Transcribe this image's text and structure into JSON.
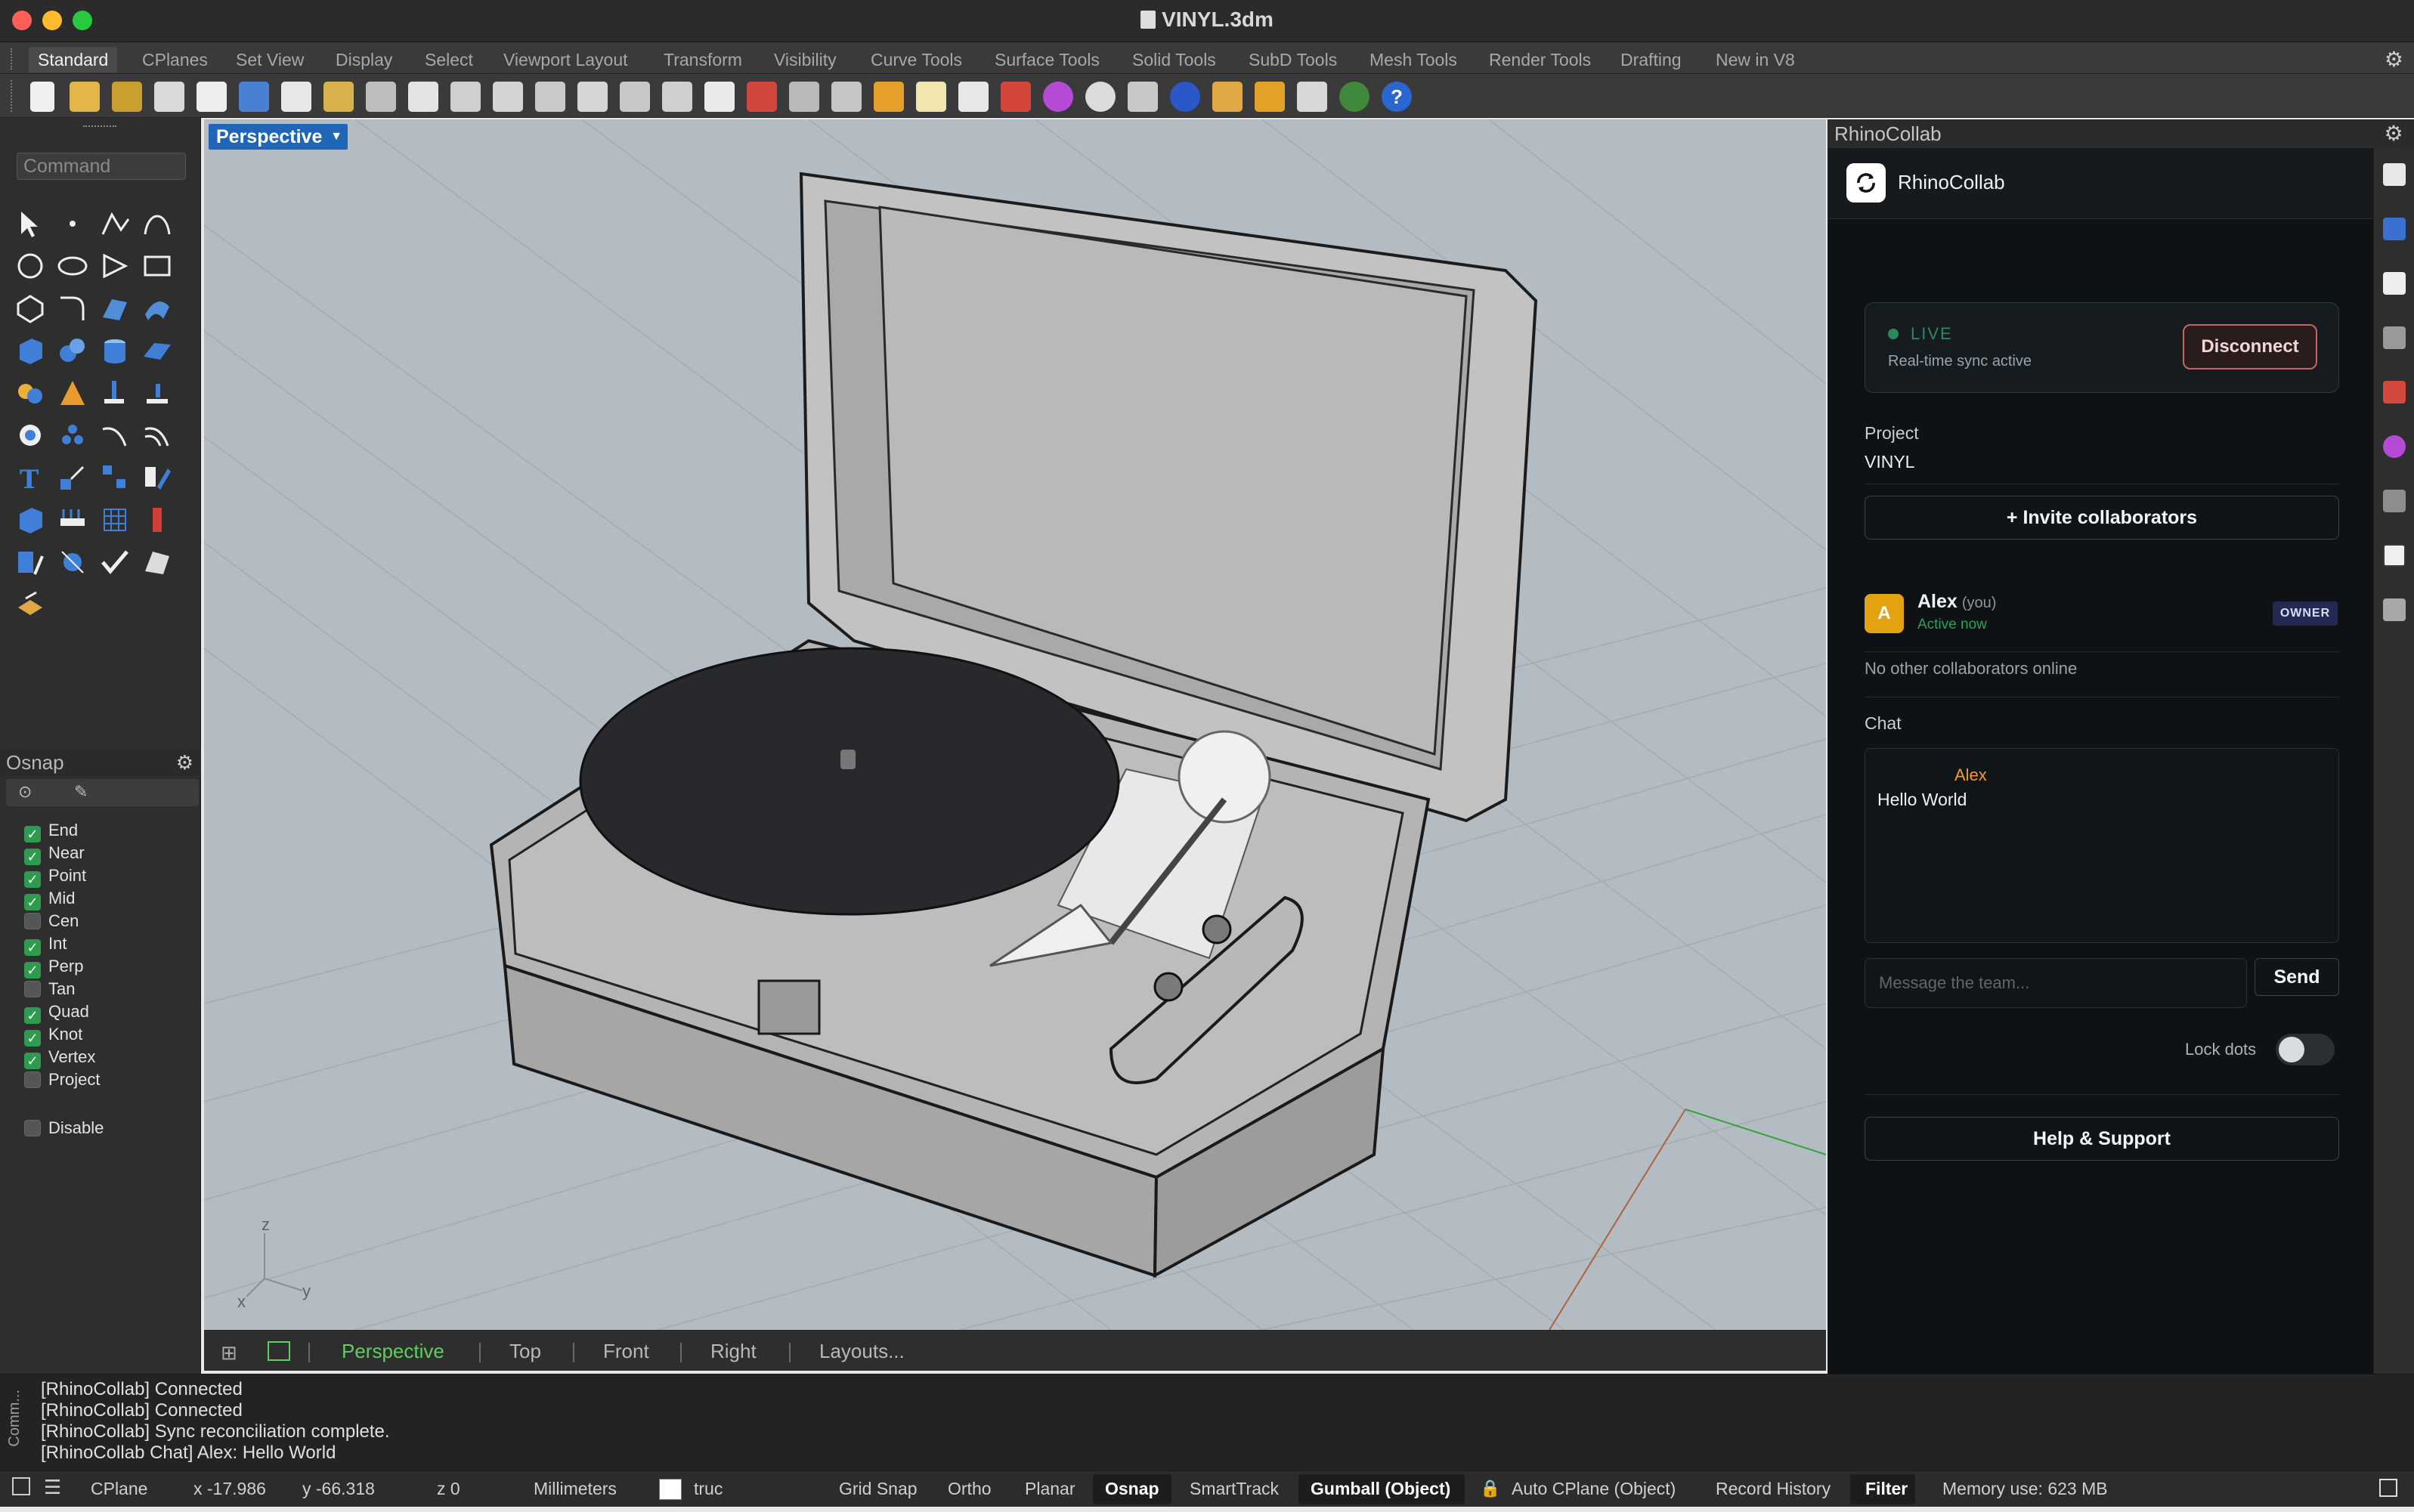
{
  "window": {
    "title": "VINYL.3dm"
  },
  "tabs": [
    "Standard",
    "CPlanes",
    "Set View",
    "Display",
    "Select",
    "Viewport Layout",
    "Transform",
    "Visibility",
    "Curve Tools",
    "Surface Tools",
    "Solid Tools",
    "SubD Tools",
    "Mesh Tools",
    "Render Tools",
    "Drafting",
    "New in V8"
  ],
  "command": {
    "placeholder": "Command"
  },
  "osnap": {
    "title": "Osnap",
    "items": [
      {
        "label": "End",
        "checked": true
      },
      {
        "label": "Near",
        "checked": true
      },
      {
        "label": "Point",
        "checked": true
      },
      {
        "label": "Mid",
        "checked": true
      },
      {
        "label": "Cen",
        "checked": false
      },
      {
        "label": "Int",
        "checked": true
      },
      {
        "label": "Perp",
        "checked": true
      },
      {
        "label": "Tan",
        "checked": false
      },
      {
        "label": "Quad",
        "checked": true
      },
      {
        "label": "Knot",
        "checked": true
      },
      {
        "label": "Vertex",
        "checked": true
      },
      {
        "label": "Project",
        "checked": false
      }
    ],
    "disable": {
      "label": "Disable",
      "checked": false
    }
  },
  "viewport": {
    "label": "Perspective",
    "axes": {
      "x": "x",
      "y": "y",
      "z": "z"
    },
    "tabs": [
      "Perspective",
      "Top",
      "Front",
      "Right",
      "Layouts..."
    ]
  },
  "plugin": {
    "panel_title": "RhinoCollab",
    "name": "RhinoCollab",
    "live": {
      "label": "LIVE",
      "sub": "Real-time sync active",
      "disconnect": "Disconnect"
    },
    "project": {
      "label": "Project",
      "value": "VINYL"
    },
    "invite": "+ Invite collaborators",
    "collaborator": {
      "initial": "A",
      "name": "Alex",
      "you": "(you)",
      "status": "Active now",
      "role": "OWNER"
    },
    "no_others": "No other collaborators online",
    "chat": {
      "label": "Chat",
      "messages": [
        {
          "author": "Alex",
          "text": "Hello World"
        }
      ],
      "placeholder": "Message the team...",
      "send": "Send"
    },
    "lock_dots": "Lock dots",
    "help": "Help & Support"
  },
  "history": {
    "side_label": "Comm...",
    "lines": [
      "[RhinoCollab] Connected",
      "[RhinoCollab] Connected",
      "[RhinoCollab] Sync reconciliation complete.",
      "[RhinoCollab Chat] Alex: Hello World"
    ]
  },
  "status": {
    "cplane": "CPlane",
    "x": "x -17.986",
    "y": "y -66.318",
    "z": "z 0",
    "units": "Millimeters",
    "layer": "truc",
    "grid_snap": "Grid Snap",
    "ortho": "Ortho",
    "planar": "Planar",
    "osnap": "Osnap",
    "smarttrack": "SmartTrack",
    "gumball": "Gumball (Object)",
    "auto_cplane": "Auto CPlane (Object)",
    "record_history": "Record History",
    "filter": "Filter",
    "memory": "Memory use: 623 MB"
  }
}
